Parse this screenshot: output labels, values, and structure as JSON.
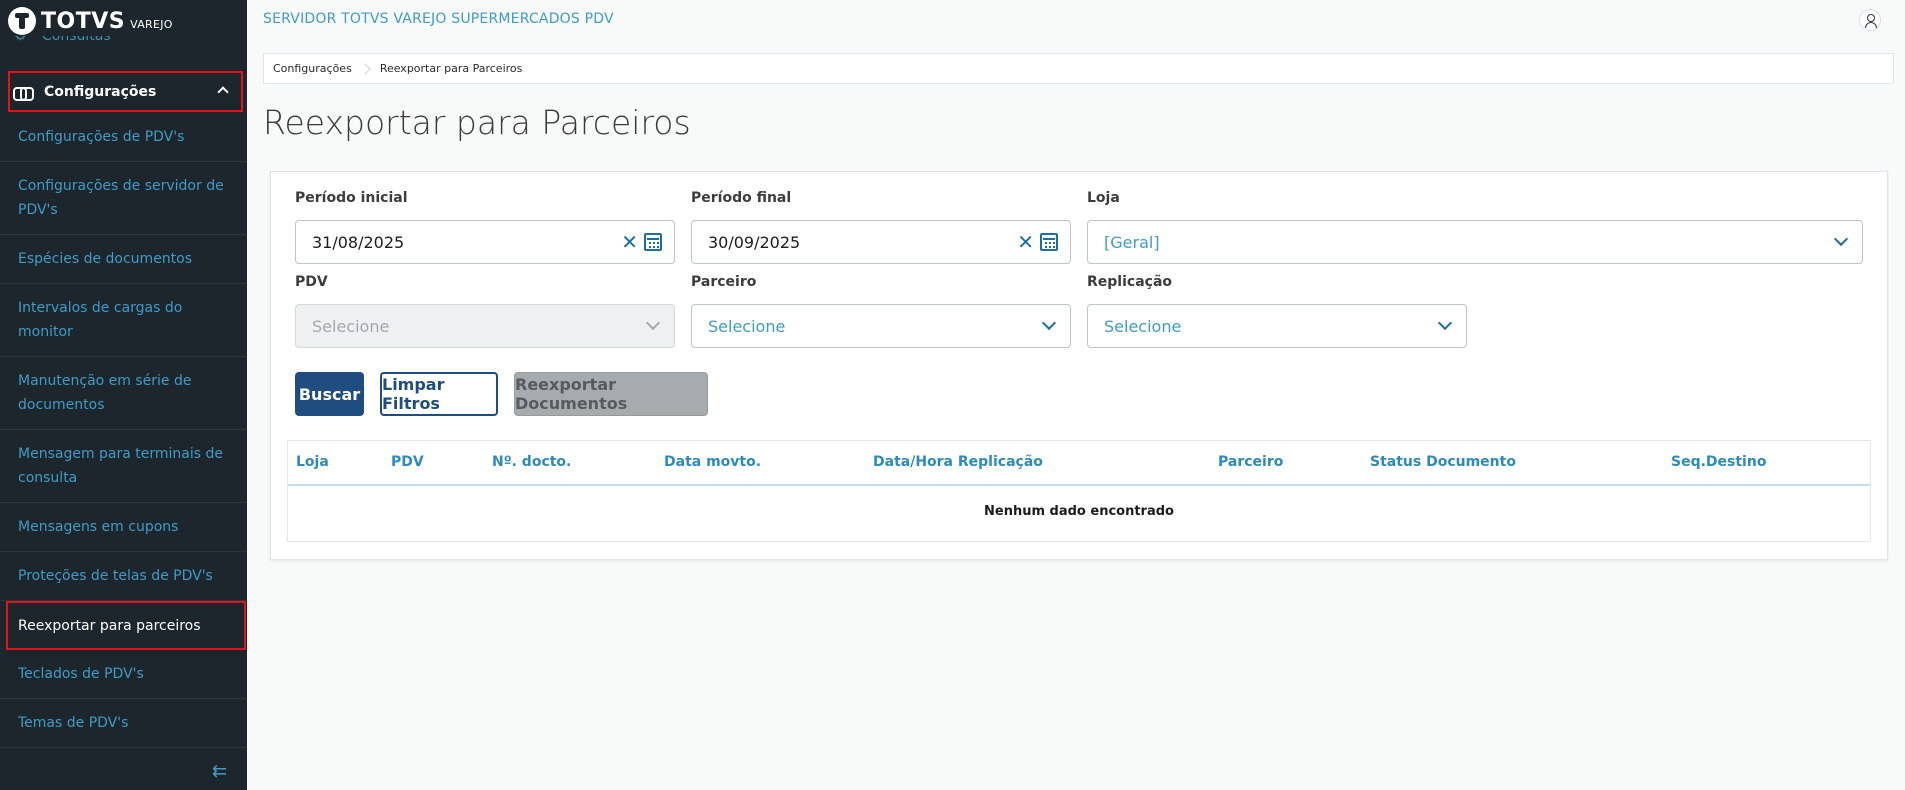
{
  "brand": {
    "name": "TOTVS",
    "sub": "VAREJO"
  },
  "sidebar": {
    "cut_item": "Consultas",
    "group_label": "Configurações",
    "items": [
      {
        "label": "Configurações de PDV's",
        "lines": 1
      },
      {
        "label": "Configurações de servidor de PDV's",
        "lines": 2
      },
      {
        "label": "Espécies de documentos",
        "lines": 1
      },
      {
        "label": "Intervalos de cargas do monitor",
        "lines": 2
      },
      {
        "label": "Manutenção em série de documentos",
        "lines": 2
      },
      {
        "label": "Mensagem para terminais de consulta",
        "lines": 2
      },
      {
        "label": "Mensagens em cupons",
        "lines": 1
      },
      {
        "label": "Proteções de telas de PDV's",
        "lines": 1
      },
      {
        "label": "Reexportar para parceiros",
        "lines": 1,
        "active": true
      },
      {
        "label": "Teclados de PDV's",
        "lines": 1
      },
      {
        "label": "Temas de PDV's",
        "lines": 1
      }
    ]
  },
  "header": {
    "title": "SERVIDOR TOTVS VAREJO SUPERMERCADOS PDV"
  },
  "breadcrumb": [
    "Configurações",
    "Reexportar para Parceiros"
  ],
  "page": {
    "title": "Reexportar para Parceiros"
  },
  "filters": {
    "periodo_inicial": {
      "label": "Período inicial",
      "value": "31/08/2025"
    },
    "periodo_final": {
      "label": "Período final",
      "value": "30/09/2025"
    },
    "loja": {
      "label": "Loja",
      "value": "[Geral]"
    },
    "pdv": {
      "label": "PDV",
      "placeholder": "Selecione"
    },
    "parceiro": {
      "label": "Parceiro",
      "placeholder": "Selecione"
    },
    "replicacao": {
      "label": "Replicação",
      "placeholder": "Selecione"
    }
  },
  "buttons": {
    "buscar": "Buscar",
    "limpar": "Limpar Filtros",
    "reexportar": "Reexportar Documentos"
  },
  "table": {
    "columns": [
      "Loja",
      "PDV",
      "Nº. docto.",
      "Data movto.",
      "Data/Hora Replicação",
      "Parceiro",
      "Status Documento",
      "Seq.Destino"
    ],
    "empty_message": "Nenhum dado encontrado"
  },
  "colors": {
    "sidebar_bg": "#1c262c",
    "link": "#3f9cc6",
    "primary": "#1f4d7f",
    "highlight": "#e1141e"
  }
}
